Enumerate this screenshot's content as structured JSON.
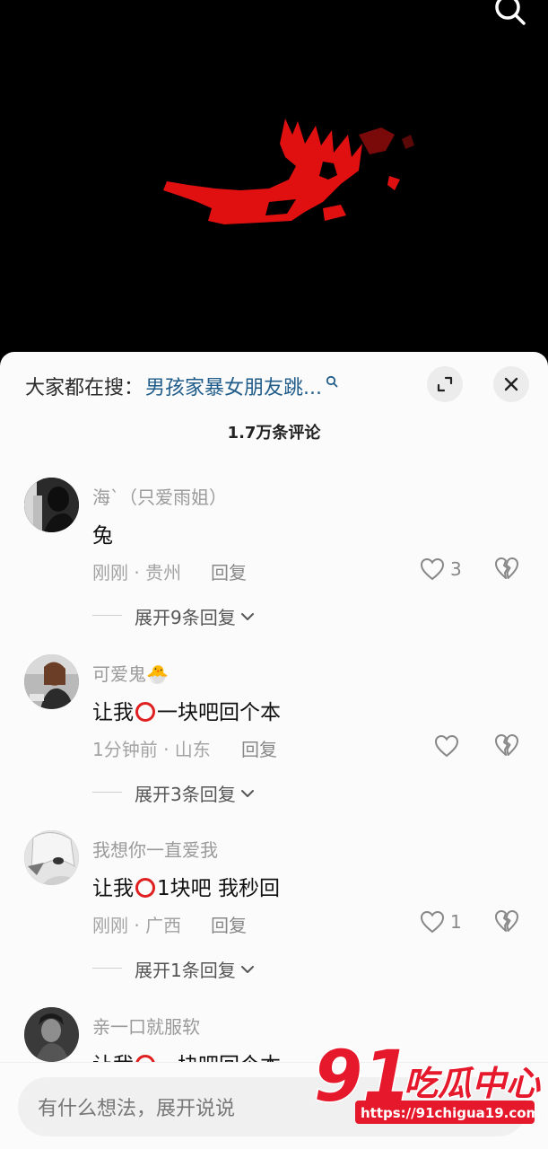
{
  "hot_search": {
    "prefix": "大家都在搜：",
    "query": "男孩家暴女朋友跳..."
  },
  "comment_count": "1.7万条评论",
  "comments": [
    {
      "username": "海`（只爱雨姐）",
      "text": "兔",
      "meta": "刚刚 · 贵州",
      "reply_label": "回复",
      "likes": "3",
      "more": "展开9条回复"
    },
    {
      "username": "可爱鬼🐣",
      "text_before": "让我",
      "text_after": "一块吧回个本",
      "meta": "1分钟前 · 山东",
      "reply_label": "回复",
      "likes": "",
      "more": "展开3条回复"
    },
    {
      "username": "我想你一直爱我",
      "text_before": "让我",
      "text_after": "1块吧 我秒回",
      "meta": "刚刚 · 广西",
      "reply_label": "回复",
      "likes": "1",
      "more": "展开1条回复"
    },
    {
      "username": "亲一口就服软",
      "text_before": "让我",
      "text_after": "一块吧回个本"
    }
  ],
  "input": {
    "placeholder": "有什么想法，展开说说"
  },
  "watermark": {
    "number": "91",
    "name": "吃瓜中心",
    "url": "https://91chigua19.com"
  },
  "colors": {
    "link": "#1f5c8a",
    "emoji_circle": "#e02020",
    "watermark_red": "#e5192b"
  },
  "icons": [
    "search-icon",
    "search-small-icon",
    "expand-icon",
    "close-icon",
    "heart-icon",
    "broken-heart-icon",
    "chevron-down-icon"
  ]
}
